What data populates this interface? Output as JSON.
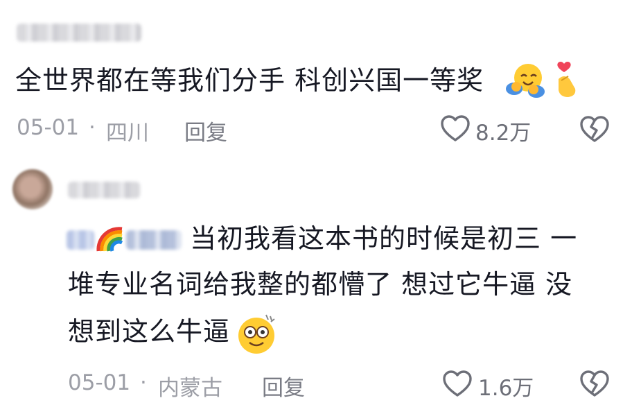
{
  "comments": [
    {
      "text_line1": "全世界都在等我们分手 科创兴国一等奖",
      "date": "05-01",
      "separator": "·",
      "location": "四川",
      "reply_label": "回复",
      "likes": "8.2万"
    },
    {
      "text_line1": "当初我看这本书的时候是初三 一",
      "text_line2": "堆专业名词给我整的都懵了 想过它牛逼 没",
      "text_line3": "想到这么牛逼",
      "date": "05-01",
      "separator": "·",
      "location": "内蒙古",
      "reply_label": "回复",
      "likes": "1.6万"
    }
  ],
  "icons": {
    "like": "heart-outline-icon",
    "dislike": "broken-heart-icon",
    "emoji_hug": "hugging-face-emoji",
    "emoji_fingerheart": "finger-heart-emoji",
    "emoji_dazed": "dizzy-face-emoji",
    "emoji_rainbow": "rainbow-emoji"
  },
  "colors": {
    "text": "#161823",
    "meta": "#9c9ea6",
    "icon": "#6d6f78"
  }
}
